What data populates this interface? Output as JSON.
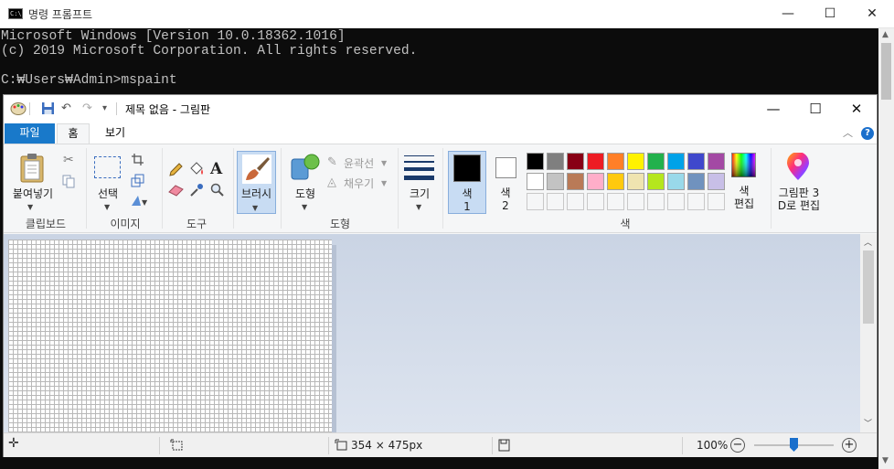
{
  "cmd": {
    "title": "명령 프롬프트",
    "icon_text": "C:\\",
    "lines": [
      "Microsoft Windows [Version 10.0.18362.1016]",
      "(c) 2019 Microsoft Corporation. All rights reserved.",
      "",
      "C:₩Users₩Admin>mspaint"
    ],
    "controls": {
      "minimize": "—",
      "maximize": "☐",
      "close": "✕"
    }
  },
  "paint": {
    "title": "제목 없음 - 그림판",
    "controls": {
      "minimize": "—",
      "maximize": "☐",
      "close": "✕"
    },
    "tabs": {
      "file": "파일",
      "home": "홈",
      "view": "보기"
    },
    "ribbon": {
      "clipboard": {
        "paste": "붙여넣기",
        "group": "클립보드"
      },
      "image": {
        "select": "선택",
        "group": "이미지"
      },
      "tools": {
        "group": "도구"
      },
      "brushes": {
        "label": "브러시"
      },
      "shapes": {
        "shapes": "도형",
        "outline": "윤곽선",
        "fill": "채우기",
        "group": "도형"
      },
      "size": {
        "label": "크기"
      },
      "colors": {
        "color1": "색\n1",
        "color2": "색\n2",
        "edit": "색\n편집",
        "group": "색",
        "palette_row1": [
          "#000000",
          "#7f7f7f",
          "#880015",
          "#ed1c24",
          "#ff7f27",
          "#fff200",
          "#22b14c",
          "#00a2e8",
          "#3f48cc",
          "#a349a4"
        ],
        "palette_row2": [
          "#ffffff",
          "#c3c3c3",
          "#b97a57",
          "#ffaec9",
          "#ffc90e",
          "#efe4b0",
          "#b5e61d",
          "#99d9ea",
          "#7092be",
          "#c8bfe7"
        ]
      },
      "paint3d": "그림판 3\nD로 편집"
    },
    "status": {
      "dimensions": "354 × 475px",
      "zoom": "100%"
    }
  }
}
